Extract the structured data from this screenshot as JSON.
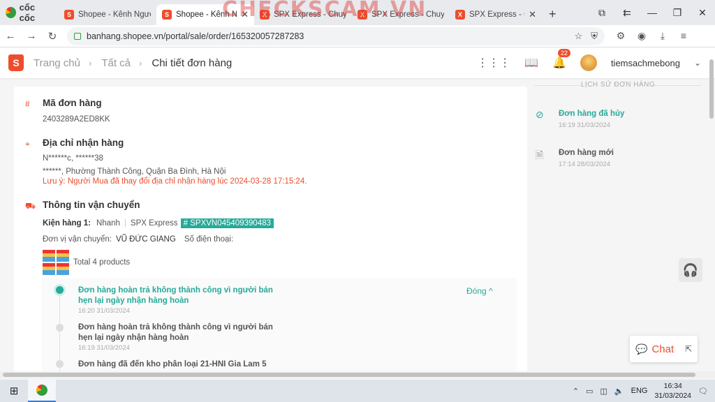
{
  "browser": {
    "brand": "cốc cốc",
    "tabs": [
      {
        "title": "Shopee - Kênh Người Bán",
        "type": "shopee"
      },
      {
        "title": "Shopee - Kênh Người Bán",
        "type": "shopee",
        "active": true,
        "close": "✕"
      },
      {
        "title": "SPX Express - Chuyển phát",
        "type": "spx"
      },
      {
        "title": "SPX Express - Chuyển phát",
        "type": "spx"
      },
      {
        "title": "SPX Express - Chuyển phát",
        "type": "spx",
        "close": "✕"
      }
    ],
    "new_tab": "+",
    "watermark": "CHECKSCAM.VN",
    "url": "banhang.shopee.vn/portal/sale/order/165320057287283"
  },
  "header": {
    "logo": "S",
    "breadcrumb": [
      "Trang chủ",
      "Tất cả",
      "Chi tiết đơn hàng"
    ],
    "separator": "›",
    "notification_count": "22",
    "shop_name": "tiemsachmebong"
  },
  "order": {
    "id_title": "Mã đơn hàng",
    "id_value": "2403289A2ED8KK",
    "address_title": "Địa chỉ nhận hàng",
    "recipient": "N******c, ******38",
    "address": "******, Phường Thành Công, Quận Ba Đình, Hà Nội",
    "address_note": "Lưu ý: Người Mua đã thay đổi địa chỉ nhận hàng lúc 2024-03-28 17:15:24.",
    "shipping_title": "Thông tin vận chuyển",
    "package_label": "Kiện hàng 1:",
    "speed": "Nhanh",
    "carrier": "SPX Express",
    "tracking": "# SPXVN045409390483",
    "shipper_label": "Đơn vị vận chuyển:",
    "shipper_name": "VŨ ĐỨC GIANG",
    "phone_label": "Số điện thoại:",
    "products_text": "Total 4 products",
    "collapse_label": "Đóng ^",
    "timeline": [
      {
        "title": "Đơn hàng hoàn trả không thành công vì người bán hẹn lại ngày nhận hàng hoàn",
        "time": "16:20 31/03/2024",
        "active": true
      },
      {
        "title": "Đơn hàng hoàn trả không thành công vì người bán hẹn lại ngày nhận hàng hoàn",
        "time": "16:19 31/03/2024",
        "active": false
      },
      {
        "title": "Đơn hàng đã đến kho phân loại 21-HNI Gia Lam 5",
        "time": "",
        "active": false
      }
    ]
  },
  "history": {
    "heading": "LỊCH SỬ ĐƠN HÀNG",
    "items": [
      {
        "title": "Đơn hàng đã hủy",
        "time": "16:19 31/03/2024",
        "icon": "cancel-icon"
      },
      {
        "title": "Đơn hàng mới",
        "time": "17:14 28/03/2024",
        "icon": "document-icon"
      }
    ]
  },
  "chat": {
    "label": "Chat"
  },
  "taskbar": {
    "lang": "ENG",
    "time": "16:34",
    "date": "31/03/2024"
  },
  "colors": {
    "shopee": "#ee4d2d",
    "teal": "#26aa99"
  }
}
